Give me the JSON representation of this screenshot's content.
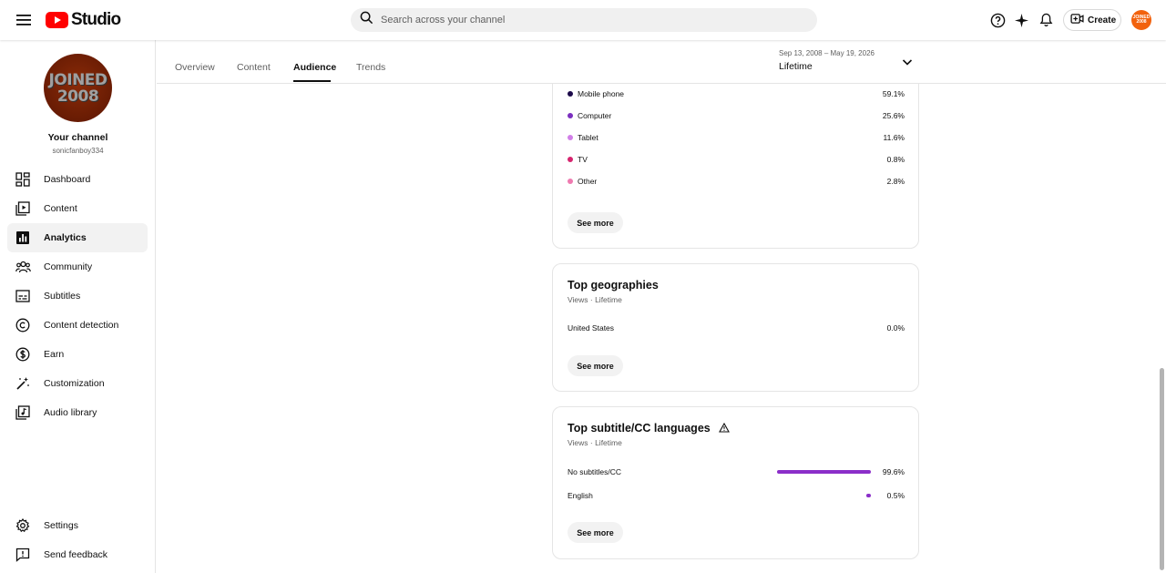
{
  "app": {
    "brand": "Studio"
  },
  "search": {
    "placeholder": "Search across your channel"
  },
  "toolbar": {
    "create_label": "Create",
    "avatar_text": "JOINED 2008"
  },
  "channel": {
    "avatar_line1": "JOINED",
    "avatar_line2": "2008",
    "title": "Your channel",
    "handle": "sonicfanboy334"
  },
  "sidebar": {
    "items": [
      {
        "label": "Dashboard",
        "icon": "dashboard-icon"
      },
      {
        "label": "Content",
        "icon": "content-icon"
      },
      {
        "label": "Analytics",
        "icon": "analytics-icon",
        "active": true
      },
      {
        "label": "Community",
        "icon": "community-icon"
      },
      {
        "label": "Subtitles",
        "icon": "subtitles-icon"
      },
      {
        "label": "Content detection",
        "icon": "copyright-icon"
      },
      {
        "label": "Earn",
        "icon": "dollar-icon"
      },
      {
        "label": "Customization",
        "icon": "magic-wand-icon"
      },
      {
        "label": "Audio library",
        "icon": "audio-library-icon"
      }
    ],
    "bottom": [
      {
        "label": "Settings",
        "icon": "gear-icon"
      },
      {
        "label": "Send feedback",
        "icon": "feedback-icon"
      }
    ]
  },
  "tabs": [
    {
      "label": "Overview"
    },
    {
      "label": "Content"
    },
    {
      "label": "Audience",
      "active": true
    },
    {
      "label": "Trends"
    }
  ],
  "date": {
    "range": "Sep 13, 2008 – May 19, 2026",
    "label": "Lifetime"
  },
  "device_type": {
    "rows": [
      {
        "label": "Mobile phone",
        "value": "59.1%",
        "color": "#1c0a4a"
      },
      {
        "label": "Computer",
        "value": "25.6%",
        "color": "#7b2fbf"
      },
      {
        "label": "Tablet",
        "value": "11.6%",
        "color": "#d17fe8"
      },
      {
        "label": "TV",
        "value": "0.8%",
        "color": "#d6246e"
      },
      {
        "label": "Other",
        "value": "2.8%",
        "color": "#ef7ab0"
      }
    ],
    "see_more": "See more"
  },
  "geographies": {
    "title": "Top geographies",
    "subtitle": "Views · Lifetime",
    "rows": [
      {
        "label": "United States",
        "value": "0.0%"
      }
    ],
    "see_more": "See more"
  },
  "subtitles": {
    "title": "Top subtitle/CC languages",
    "subtitle": "Views · Lifetime",
    "bar_color": "#8b2ec9",
    "rows": [
      {
        "label": "No subtitles/CC",
        "value": "99.6%",
        "share": 99.6
      },
      {
        "label": "English",
        "value": "0.5%",
        "share": 0.5
      }
    ],
    "see_more": "See more"
  }
}
